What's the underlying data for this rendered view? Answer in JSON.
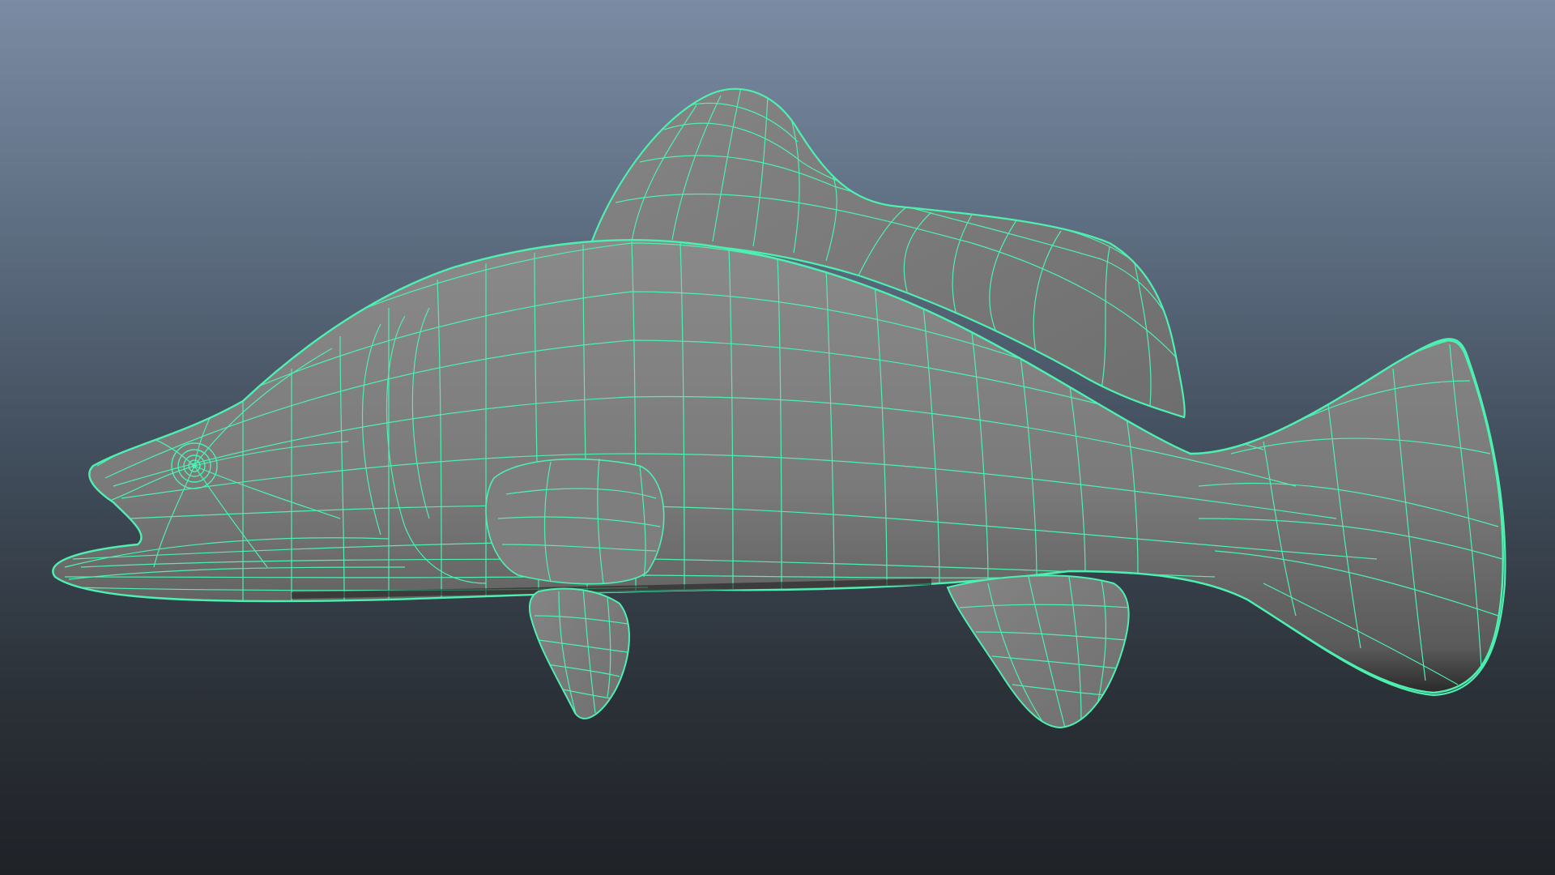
{
  "viewport": {
    "background_top": "#7b8ba3",
    "background_bottom": "#1f2227",
    "shading": "wireframe-on-shaded"
  },
  "model": {
    "object": "fish-mesh",
    "surface_color": "#7c7c7c",
    "wireframe_color": "#4df0b0"
  }
}
